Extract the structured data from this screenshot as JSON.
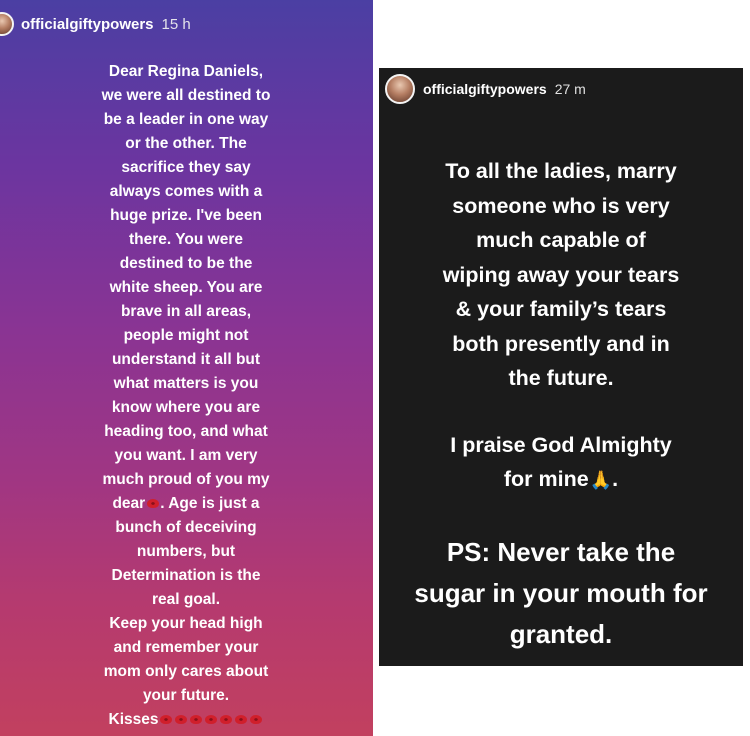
{
  "left_story": {
    "username": "officialgiftypowers",
    "timestamp": "15 h",
    "lines": [
      "Dear Regina Daniels,",
      "we were all destined to",
      "be a leader in one way",
      "or the other. The",
      "sacrifice they say",
      "always comes with a",
      "huge prize. I've been",
      "there. You were",
      "destined to be the",
      "white sheep. You are",
      "brave in all areas,",
      "people might not",
      "understand it all but",
      "what matters is you",
      "know where you are",
      "heading too, and what",
      "you want. I am very",
      "much proud of you my"
    ],
    "line_dear": "dear",
    "line_age": ". Age is just a",
    "lines_after": [
      "bunch of deceiving",
      "numbers, but",
      "Determination is the",
      "real goal.",
      "Keep your head high",
      "and remember your",
      "mom only cares about",
      "your future."
    ],
    "kisses_label": "Kisses",
    "emoji_icon": "lips-icon"
  },
  "right_story": {
    "username": "officialgiftypowers",
    "timestamp": "27 m",
    "paragraph1": [
      "To all the ladies, marry",
      "someone who is very",
      "much capable of",
      "wiping away your tears",
      "& your family’s tears",
      "both presently and in",
      "the future."
    ],
    "paragraph2_line1": "I praise God Almighty",
    "paragraph2_line2_before": "for mine",
    "paragraph2_line2_after": ".",
    "praying_icon": "praying-hands-icon",
    "paragraph3": [
      "PS: Never take the",
      "sugar in your mouth for",
      "granted."
    ]
  }
}
